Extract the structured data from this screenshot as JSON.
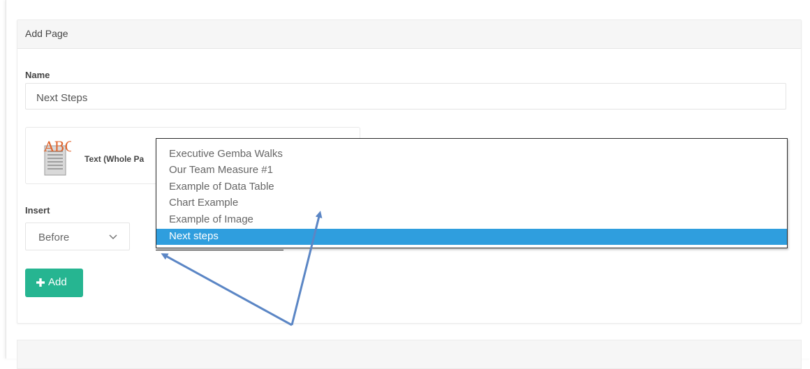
{
  "panel": {
    "title": "Add Page"
  },
  "form": {
    "name_label": "Name",
    "name_value": "Next Steps",
    "template_label": "Text (Whole Pa",
    "template_icon_text": "ABC",
    "insert_label": "Insert",
    "insert_value": "Before",
    "add_button_label": "Add"
  },
  "dropdown": {
    "options": [
      "Executive Gemba Walks",
      "Our Team Measure #1",
      "Example of Data Table",
      "Chart Example",
      "Example of Image",
      "Next steps"
    ],
    "selected": "Next steps"
  },
  "colors": {
    "accent_green": "#26b591",
    "selection_blue": "#2f9ede",
    "arrow_blue": "#5b86c5",
    "icon_orange": "#e0642c"
  },
  "icons": {
    "template": "text-document-icon",
    "chevron": "chevron-down-icon",
    "plus": "plus-icon"
  }
}
